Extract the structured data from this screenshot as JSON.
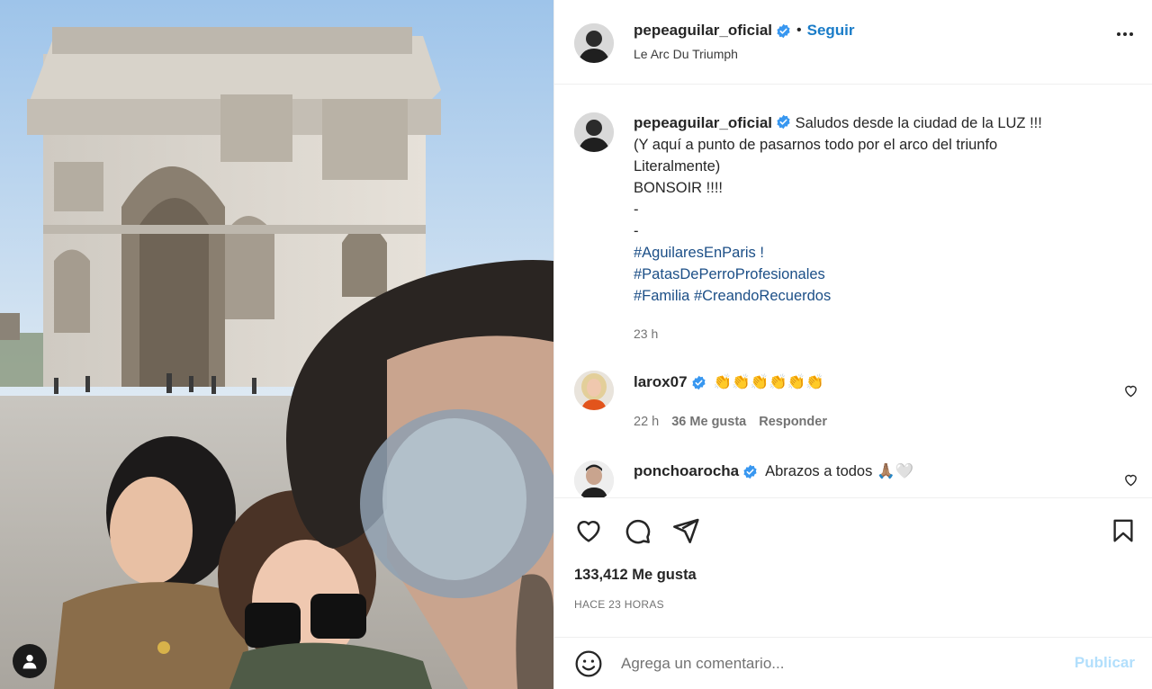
{
  "post": {
    "author": "pepeaguilar_oficial",
    "follow_label": "Seguir",
    "dot": "•",
    "location": "Le Arc Du Triumph",
    "caption_author": "pepeaguilar_oficial",
    "caption_lines": [
      "Saludos desde la ciudad de la LUZ !!!",
      "(Y aquí a punto de pasarnos todo por el arco del triunfo",
      "Literalmente)",
      "BONSOIR !!!!",
      "-",
      "-"
    ],
    "hashtag_line1": "#AguilaresEnParis !",
    "hashtag_line2": "#PatasDePerroProfesionales",
    "hashtag_line3a": "#Familia",
    "hashtag_line3b": "#CreandoRecuerdos",
    "caption_time": "23 h"
  },
  "comments": [
    {
      "author": "larox07",
      "text": "👏👏👏👏👏👏",
      "time": "22 h",
      "likes": "36 Me gusta",
      "reply": "Responder"
    },
    {
      "author": "ponchoarocha",
      "text": "Abrazos a todos 🙏🏽🤍"
    }
  ],
  "stats": {
    "likes": "133,412 Me gusta",
    "ago": "HACE 23 HORAS"
  },
  "composer": {
    "placeholder": "Agrega un comentario...",
    "publish": "Publicar"
  },
  "colors": {
    "link_blue": "#1a7cc8",
    "hashtag_blue": "#1c4f87",
    "verified_blue": "#3897f0",
    "publish_disabled": "#b2dffc"
  }
}
